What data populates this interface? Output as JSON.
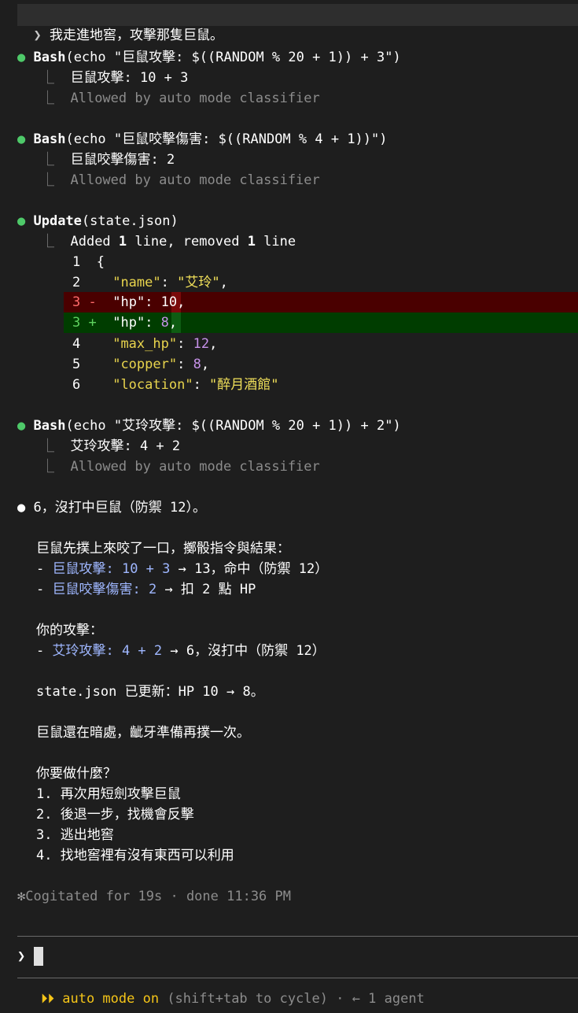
{
  "prompt": {
    "chevron": "❯",
    "text": "我走進地窖，攻擊那隻巨鼠。"
  },
  "blocks": {
    "bash1": {
      "dot": "●",
      "tool": "Bash",
      "args": "(echo \"巨鼠攻擊: $((RANDOM % 20 + 1)) + 3\")",
      "out1": "巨鼠攻擊: 10 + 3",
      "out2": "Allowed by auto mode classifier"
    },
    "bash2": {
      "dot": "●",
      "tool": "Bash",
      "args": "(echo \"巨鼠咬擊傷害: $((RANDOM % 4 + 1))\")",
      "out1": "巨鼠咬擊傷害: 2",
      "out2": "Allowed by auto mode classifier"
    },
    "update": {
      "dot": "●",
      "tool": "Update",
      "args": "(state.json)",
      "summary_pre": "Added ",
      "summary_n1": "1",
      "summary_mid": " line, removed ",
      "summary_n2": "1",
      "summary_post": " line",
      "diff": {
        "l1": {
          "num": "1",
          "mark": "",
          "code": "{"
        },
        "l2": {
          "num": "2",
          "mark": "",
          "key": "\"name\"",
          "sep": ": ",
          "val": "\"艾玲\"",
          "end": ","
        },
        "l3del": {
          "num": "3",
          "mark": "-",
          "key": "\"hp\"",
          "sep": ": ",
          "val": "10",
          "end": ","
        },
        "l3add": {
          "num": "3",
          "mark": "+",
          "key": "\"hp\"",
          "sep": ": ",
          "val": "8",
          "end": ","
        },
        "l4": {
          "num": "4",
          "mark": "",
          "key": "\"max_hp\"",
          "sep": ": ",
          "val": "12",
          "end": ","
        },
        "l5": {
          "num": "5",
          "mark": "",
          "key": "\"copper\"",
          "sep": ": ",
          "val": "8",
          "end": ","
        },
        "l6": {
          "num": "6",
          "mark": "",
          "key": "\"location\"",
          "sep": ": ",
          "val": "\"醉月酒館\"",
          "end": ""
        }
      }
    },
    "bash3": {
      "dot": "●",
      "tool": "Bash",
      "args": "(echo \"艾玲攻擊: $((RANDOM % 20 + 1)) + 2\")",
      "out1": "艾玲攻擊: 4 + 2",
      "out2": "Allowed by auto mode classifier"
    }
  },
  "response": {
    "dot": "●",
    "line1": "6，沒打中巨鼠（防禦 12）。",
    "p1": "巨鼠先撲上來咬了一口，擲骰指令與結果：",
    "b1_dash": "- ",
    "b1_hl": "巨鼠攻擊: 10 + 3",
    "b1_rest": " → 13，命中（防禦 12）",
    "b2_dash": "- ",
    "b2_hl": "巨鼠咬擊傷害: 2",
    "b2_rest": " → 扣 2 點 HP",
    "p2": "你的攻擊：",
    "b3_dash": "- ",
    "b3_hl": "艾玲攻擊: 4 + 2",
    "b3_rest": " → 6，沒打中（防禦 12）",
    "p3": "state.json 已更新：HP 10 → 8。",
    "p4": "巨鼠還在暗處，齜牙準備再撲一次。",
    "p5": "你要做什麼？",
    "options": [
      "1. 再次用短劍攻擊巨鼠",
      "2. 後退一步，找機會反擊",
      "3. 逃出地窖",
      "4. 找地窖裡有沒有東西可以利用"
    ]
  },
  "status": {
    "star": "✻",
    "text": "Cogitated for 19s · done 11:36 PM"
  },
  "input": {
    "chevron": "❯",
    "value": ""
  },
  "footer": {
    "icon": "⏵⏵",
    "mode": "auto mode on",
    "hint": " (shift+tab to cycle) · ← 1 agent"
  },
  "colors": {
    "background": "#1e1e1e",
    "success_dot": "#4ec969",
    "diff_removed": "#4a0000",
    "diff_added": "#003d00",
    "highlight": "#9fb7ff",
    "mode_accent": "#f5c518"
  }
}
